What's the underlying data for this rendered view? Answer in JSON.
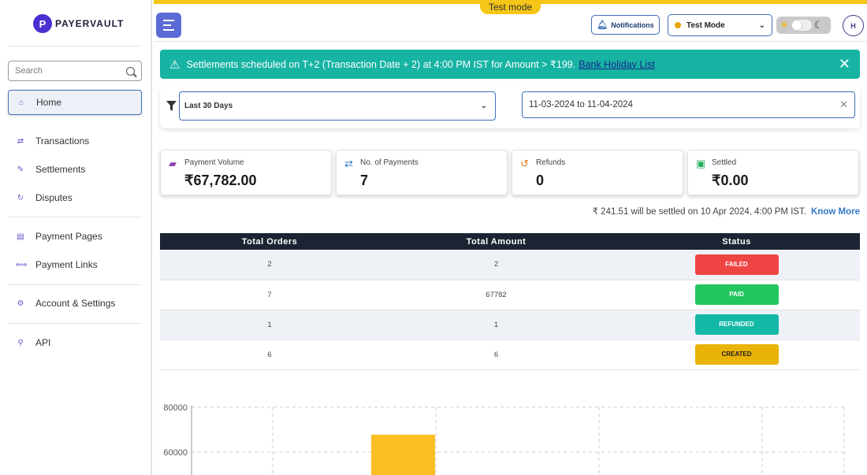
{
  "app": {
    "brand": "PAYERVAULT",
    "brand_mark": "P",
    "test_mode_label": "Test mode"
  },
  "sidebar": {
    "search_placeholder": "Search",
    "items": [
      {
        "label": "Home",
        "icon": "home-icon",
        "active": true
      },
      {
        "label": "Transactions",
        "icon": "arrows-icon"
      },
      {
        "label": "Settlements",
        "icon": "pen-icon"
      },
      {
        "label": "Disputes",
        "icon": "refresh-icon"
      },
      {
        "label": "Payment Pages",
        "icon": "page-icon"
      },
      {
        "label": "Payment Links",
        "icon": "link-icon"
      },
      {
        "label": "Account & Settings",
        "icon": "gear-icon"
      },
      {
        "label": "API",
        "icon": "api-icon"
      }
    ]
  },
  "header": {
    "notifications_label": "Notifications",
    "mode_select": "Test Mode",
    "avatar_initial": "H"
  },
  "banner": {
    "text": "Settlements scheduled on T+2 (Transaction Date + 2) at 4:00 PM IST for Amount > ₹199.",
    "link": "Bank Holiday List"
  },
  "filter": {
    "range": "Last 30 Days",
    "dates": "11-03-2024 to 11-04-2024"
  },
  "stats": [
    {
      "label": "Payment Volume",
      "value": "₹67,782.00",
      "icon": "wallet-icon",
      "color": "#8e44ad"
    },
    {
      "label": "No. of Payments",
      "value": "7",
      "icon": "exchange-icon",
      "color": "#3478c8"
    },
    {
      "label": "Refunds",
      "value": "0",
      "icon": "refund-icon",
      "color": "#e67e22"
    },
    {
      "label": "Settled",
      "value": "₹0.00",
      "icon": "cash-icon",
      "color": "#27ae60"
    }
  ],
  "settle_note": {
    "text": "₹ 241.51 will be settled on 10 Apr 2024, 4:00 PM IST.",
    "link": "Know More"
  },
  "table": {
    "headers": [
      "Total Orders",
      "Total Amount",
      "Status"
    ],
    "rows": [
      {
        "orders": "2",
        "amount": "2",
        "status": "FAILED",
        "color": "#ef4444"
      },
      {
        "orders": "7",
        "amount": "67782",
        "status": "PAID",
        "color": "#22c55e"
      },
      {
        "orders": "1",
        "amount": "1",
        "status": "REFUNDED",
        "color": "#14b8a6"
      },
      {
        "orders": "6",
        "amount": "6",
        "status": "CREATED",
        "color": "#eab308"
      }
    ]
  },
  "chart_data": {
    "type": "bar",
    "y_ticks": [
      "80000",
      "60000"
    ],
    "ylim": [
      60000,
      80000
    ],
    "bar_color": "#fbbf24",
    "values": [
      67782
    ]
  }
}
